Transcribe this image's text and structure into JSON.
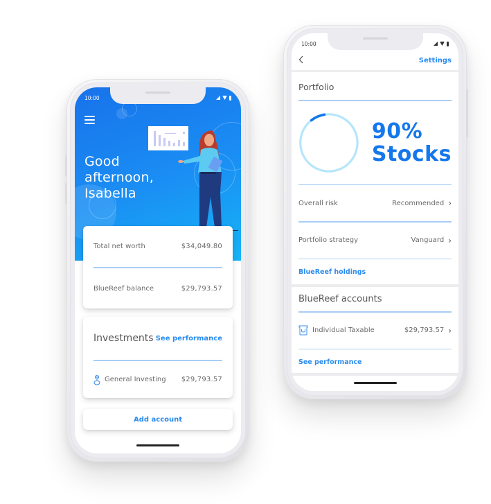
{
  "colors": {
    "accent": "#2a8cf0",
    "hero_start": "#1872ea",
    "hero_end": "#16b4f6",
    "divider": "#a9cdf5",
    "gauge_track": "#b5e6fb",
    "gauge_fill": "#1577ec"
  },
  "left_phone": {
    "status": {
      "time": "10:00"
    },
    "greeting": [
      "Good",
      "afternoon,",
      "Isabella"
    ],
    "summary": {
      "rows": [
        {
          "label": "Total net worth",
          "value": "$34,049.80"
        },
        {
          "label": "BlueReef balance",
          "value": "$29,793.57"
        }
      ]
    },
    "investments": {
      "title": "Investments",
      "link": "See performance",
      "accounts": [
        {
          "icon": "piggy-bank-icon",
          "label": "General Investing",
          "value": "$29,793.57"
        }
      ]
    },
    "add_account": "Add account"
  },
  "right_phone": {
    "status": {
      "time": "10:00"
    },
    "topbar": {
      "back": "<",
      "settings": "Settings"
    },
    "portfolio": {
      "title": "Portfolio",
      "allocation_percent": 90,
      "allocation_label_pct": "90%",
      "allocation_label_type": "Stocks",
      "rows": [
        {
          "label": "Overall risk",
          "value": "Recommended"
        },
        {
          "label": "Portfolio strategy",
          "value": "Vanguard"
        }
      ],
      "holdings_link": "BlueReef holdings"
    },
    "accounts": {
      "title": "BlueReef accounts",
      "items": [
        {
          "icon": "jar-icon",
          "label": "Individual Taxable",
          "value": "$29,793.57"
        }
      ],
      "link": "See performance"
    }
  }
}
